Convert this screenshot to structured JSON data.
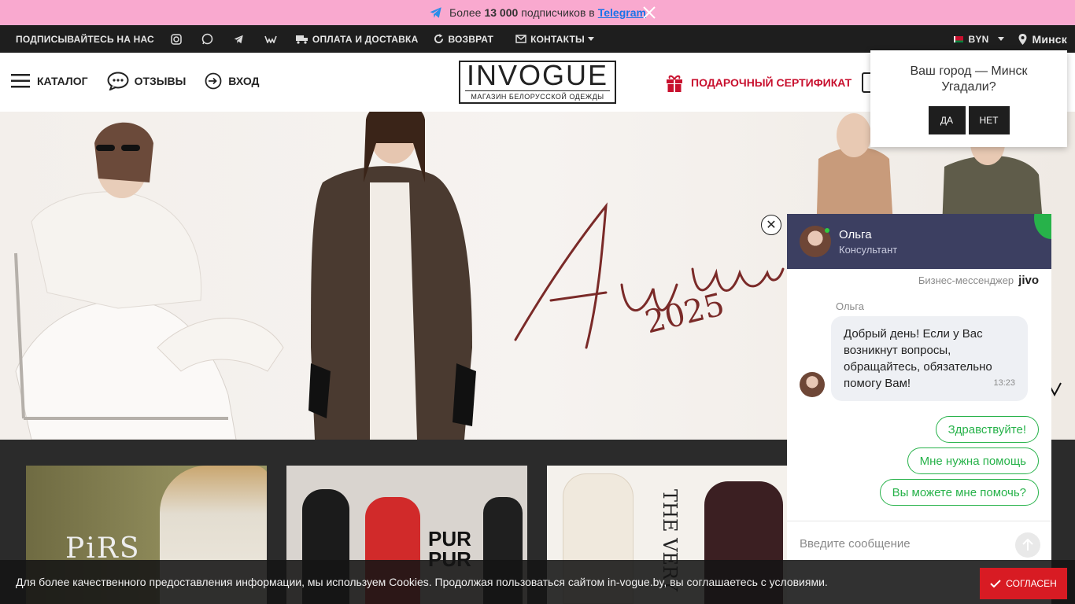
{
  "promo": {
    "text_before": "Более",
    "count": "13 000",
    "text_after": "подписчиков в",
    "link": "Telegram"
  },
  "topbar": {
    "subscribe": "ПОДПИСЫВАЙТЕСЬ НА НАС",
    "payment": "ОПЛАТА И ДОСТАВКА",
    "return": "ВОЗВРАТ",
    "contacts": "КОНТАКТЫ",
    "currency": "BYN",
    "city": "Минск"
  },
  "header": {
    "catalog": "КАТАЛОГ",
    "reviews": "ОТЗЫВЫ",
    "login": "ВХОД",
    "logo_main": "INVOGUE",
    "logo_sub": "МАГАЗИН БЕЛОРУССКОЙ ОДЕЖДЫ",
    "gift": "ПОДАРОЧНЫЙ СЕРТИФИКАТ"
  },
  "hero": {
    "script": "Autumn",
    "year": "2025"
  },
  "cards": [
    {
      "brand": "PiRS"
    },
    {
      "brand_line1": "PUR",
      "brand_line2": "PUR"
    },
    {
      "brand": "THE VERY"
    }
  ],
  "city_popup": {
    "question_line1": "Ваш город — Минск",
    "question_line2": "Угадали?",
    "yes": "ДА",
    "no": "НЕТ"
  },
  "chat": {
    "agent_name": "Ольга",
    "agent_role": "Консультант",
    "brand_text": "Бизнес-мессенджер",
    "brand_logo": "jivo",
    "sender": "Ольга",
    "message": "Добрый день! Если у Вас возникнут вопросы, обращайтесь, обязательно помогу Вам!",
    "time": "13:23",
    "quick_replies": [
      "Здравствуйте!",
      "Мне нужна помощь",
      "Вы можете мне помочь?"
    ],
    "input_placeholder": "Введите сообщение"
  },
  "cookie": {
    "text": "Для более качественного предоставления информации, мы используем Cookies. Продолжая пользоваться сайтом in-vogue.by, вы соглашаетесь с условиями.",
    "agree": "СОГЛАСЕН"
  },
  "colors": {
    "promo_bg": "#f9a9cf",
    "topbar_bg": "#1e1e1e",
    "accent_red": "#c8102e",
    "chat_head": "#3c3f61",
    "chat_green": "#27b24a"
  }
}
